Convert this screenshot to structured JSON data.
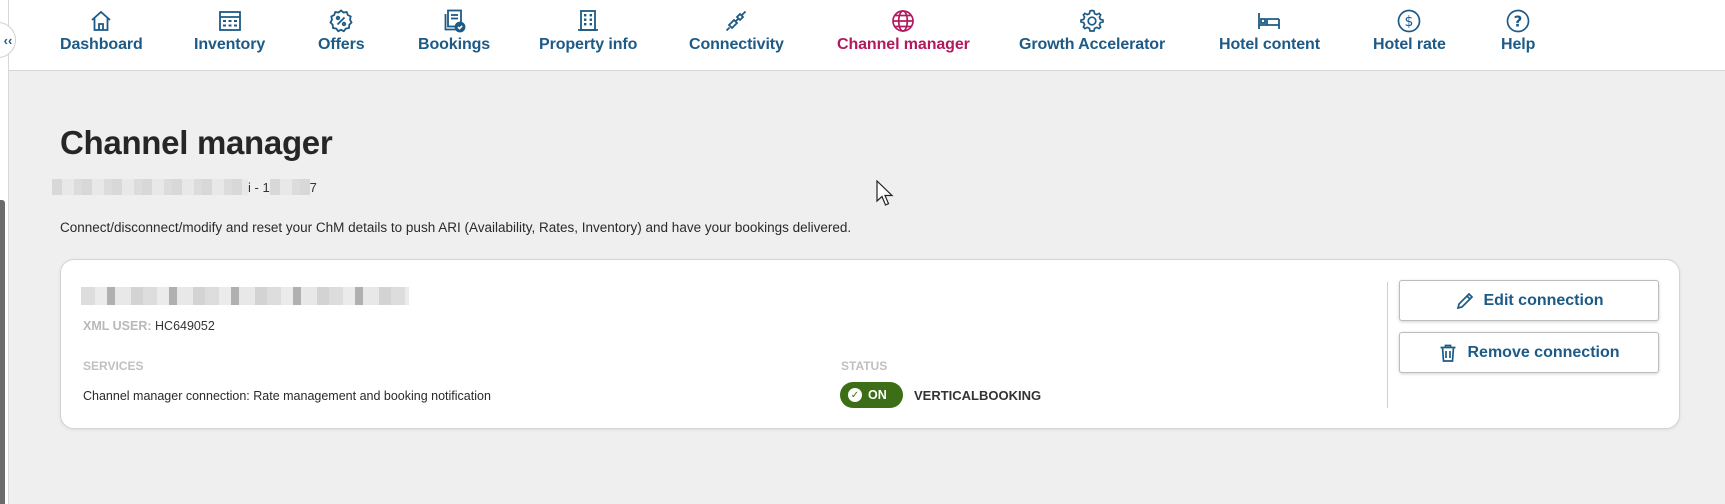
{
  "nav": {
    "items": [
      {
        "label": "Dashboard",
        "icon": "home-icon"
      },
      {
        "label": "Inventory",
        "icon": "calendar-grid-icon"
      },
      {
        "label": "Offers",
        "icon": "percent-badge-icon"
      },
      {
        "label": "Bookings",
        "icon": "document-check-icon"
      },
      {
        "label": "Property info",
        "icon": "building-icon"
      },
      {
        "label": "Connectivity",
        "icon": "plug-icon"
      },
      {
        "label": "Channel manager",
        "icon": "globe-icon"
      },
      {
        "label": "Growth Accelerator",
        "icon": "gear-icon"
      },
      {
        "label": "Hotel content",
        "icon": "bed-icon"
      },
      {
        "label": "Hotel rate",
        "icon": "dollar-circle-icon"
      },
      {
        "label": "Help",
        "icon": "question-circle-icon"
      }
    ],
    "active": "Channel manager"
  },
  "page": {
    "title": "Channel manager",
    "hotel_id_mid": "i - 1",
    "hotel_id_end": "7",
    "description": "Connect/disconnect/modify and reset your ChM details to push ARI (Availability, Rates, Inventory) and have your bookings delivered."
  },
  "connection": {
    "xml_user_label": "XML USER:",
    "xml_user_value": "HC649052",
    "services_label": "SERVICES",
    "services_value": "Channel manager connection: Rate management and booking notification",
    "status_label": "STATUS",
    "status_toggle": "ON",
    "status_provider": "VERTICALBOOKING",
    "edit_button": "Edit connection",
    "remove_button": "Remove connection"
  },
  "colors": {
    "nav_blue": "#1d5a86",
    "nav_active": "#b3195f",
    "status_green": "#3c6e18"
  }
}
